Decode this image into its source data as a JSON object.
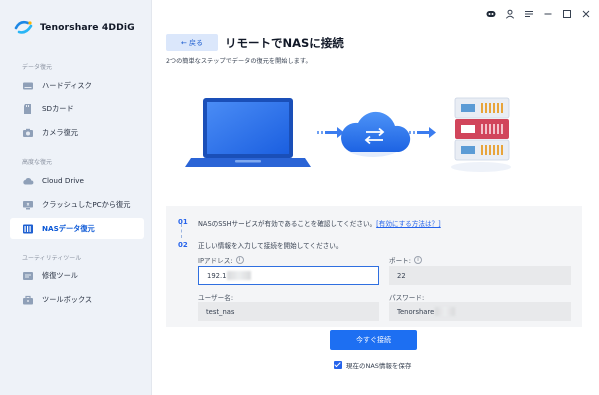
{
  "app": {
    "name": "Tenorshare 4DDiG"
  },
  "sidebar": {
    "sections": [
      {
        "label": "データ復元"
      },
      {
        "label": "高度な復元"
      },
      {
        "label": "ユーティリティツール"
      }
    ],
    "items": [
      {
        "label": "ハードディスク",
        "icon": "hard-disk-icon"
      },
      {
        "label": "SDカード",
        "icon": "sd-card-icon"
      },
      {
        "label": "カメラ復元",
        "icon": "camera-icon"
      },
      {
        "label": "Cloud Drive",
        "icon": "cloud-drive-icon"
      },
      {
        "label": "クラッシュしたPCから復元",
        "icon": "crashed-pc-icon"
      },
      {
        "label": "NASデータ復元",
        "icon": "nas-icon",
        "active": true
      },
      {
        "label": "修復ツール",
        "icon": "repair-icon"
      },
      {
        "label": "ツールボックス",
        "icon": "toolbox-icon"
      }
    ]
  },
  "header": {
    "back_label": "← 戻る",
    "title": "リモートでNASに接続",
    "subtitle": "2つの簡単なステップでデータの復元を開始します。"
  },
  "steps": [
    {
      "num": "01",
      "text": "NASのSSHサービスが有効であることを確認してください。",
      "link": "[有効にする方法は？]"
    },
    {
      "num": "02",
      "text": "正しい情報を入力して接続を開始してください。"
    }
  ],
  "form": {
    "ip_label": "IPアドレス:",
    "ip_value": "192.1",
    "port_label": "ポート:",
    "port_value": "22",
    "user_label": "ユーザー名:",
    "user_value": "test_nas",
    "password_label": "パスワード:",
    "password_value": "Tenorshare"
  },
  "actions": {
    "connect_label": "今すぐ接続",
    "save_label": "現在のNAS情報を保存",
    "save_checked": true
  },
  "colors": {
    "accent": "#1d6ff2",
    "sidebar_bg": "#eef2f8",
    "active_text": "#0a57d6"
  }
}
